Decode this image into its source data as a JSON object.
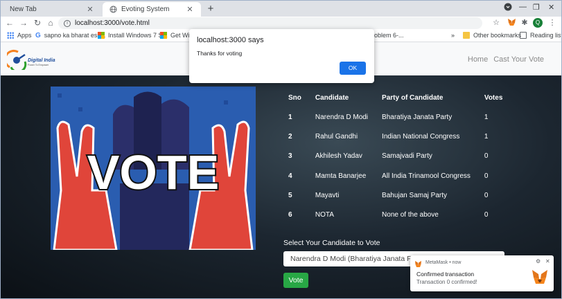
{
  "tabs": [
    {
      "label": "New Tab",
      "active": false
    },
    {
      "label": "Evoting System",
      "active": true
    }
  ],
  "toolbar": {
    "url": "localhost:3000/vote.html",
    "avatar_letter": "Q"
  },
  "bookmarks": {
    "items": [
      {
        "label": "Apps",
        "icon": "apps-grid-icon"
      },
      {
        "label": "sapno ka bharat ess...",
        "icon": "google-icon"
      },
      {
        "label": "Install Windows 7 S...",
        "icon": "windows-icon"
      },
      {
        "label": "Get Wind",
        "icon": "windows-icon"
      },
      {
        "label": "oblem 6-...",
        "icon": ""
      }
    ],
    "overflow": "»",
    "other": "Other bookmarks",
    "reading_list": "Reading list"
  },
  "navbar": {
    "logo_text": "Digital India",
    "logo_tagline": "Power To Empower",
    "links": [
      "Home",
      "Cast Your Vote"
    ]
  },
  "hero": {
    "image_word": "VOTE",
    "table": {
      "headers": [
        "Sno",
        "Candidate",
        "Party of Candidate",
        "Votes"
      ],
      "rows": [
        [
          "1",
          "Narendra D Modi",
          "Bharatiya Janata Party",
          "1"
        ],
        [
          "2",
          "Rahul Gandhi",
          "Indian National Congress",
          "1"
        ],
        [
          "3",
          "Akhilesh Yadav",
          "Samajvadi Party",
          "0"
        ],
        [
          "4",
          "Mamta Banarjee",
          "All India Trinamool Congress",
          "0"
        ],
        [
          "5",
          "Mayavti",
          "Bahujan Samaj Party",
          "0"
        ],
        [
          "6",
          "NOTA",
          "None of the above",
          "0"
        ]
      ]
    },
    "select_label": "Select Your Candidate to Vote",
    "select_value": "Narendra D Modi (Bharatiya Janata Party)",
    "vote_button": "Vote"
  },
  "dialog": {
    "title": "localhost:3000 says",
    "message": "Thanks for voting",
    "ok": "OK"
  },
  "metamask": {
    "brand": "MetaMask • now",
    "title": "Confirmed transaction",
    "message": "Transaction 0 confirmed!"
  },
  "colors": {
    "vote_button": "#28a745",
    "ok_button": "#1a73e8",
    "avatar": "#188038"
  }
}
